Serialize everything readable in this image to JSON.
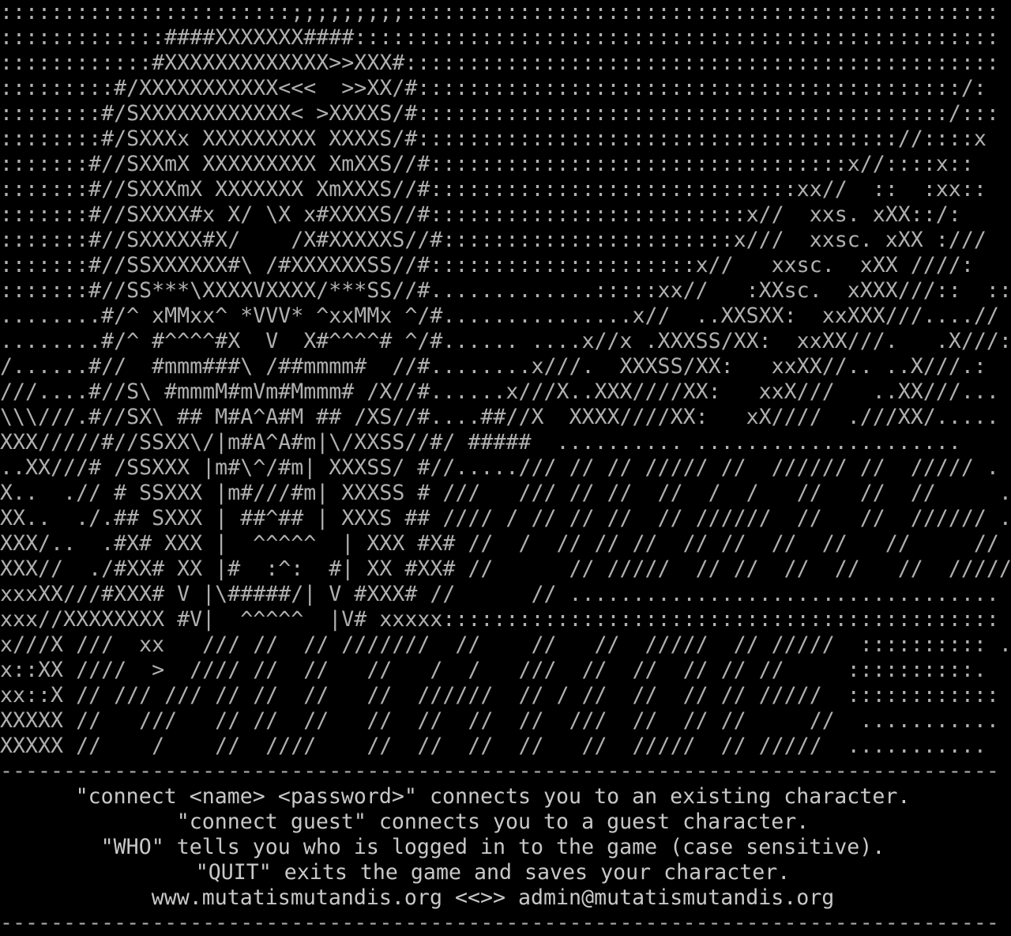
{
  "terminal": {
    "ascii_art": [
      ":::::::::::::::::::::::;;;;;;;;;:::::::::::::::::::::::::::::::::::::::::::::::",
      ":::::::::::::####XXXXXXX####:::::::::::::::::::::::::::::::::::::::::::::::::::",
      "::::::::::::#XXXXXXXXXXXXX>>XXX#:::::::::::::::::::::::::::::::::::::::::::::::",
      ":::::::::#/XXXXXXXXXXX<<<  >>XX/#:::::::::::::::::::::::::::::::::::::::::::/:",
      "::::::::#/SXXXXXXXXXXXX< >XXXXS/#::::::::::::::::::::::::::::::::::::::::::/:::",
      "::::::::#/SXXXx XXXXXXXXX XXXXS/#:::::::::::::::::::::::::::::::::::::://::::x",
      ":::::::#//SXXmX XXXXXXXXX XmXXS//#:::::::::::::::::::::::::::::::::x//::::x::",
      ":::::::#//SXXXmX XXXXXXX XmXXXS//#:::::::::::::::::::::::::::::xx//  ::  :xx::",
      ":::::::#//SXXXX#x X/ \\X x#XXXXS//#:::::::::::::::::::::::::x//  xxs. xXX::/:",
      ":::::::#//SXXXXX#X/    /X#XXXXXS//#:::::::::::::::::::::::x///  xxsc. xXX :///",
      ":::::::#//SSXXXXXX#\\ /#XXXXXXSS//#:::::::::::::::::::::x//   xxsc.  xXX ////:",
      ":::::::#//SS***\\XXXXVXXXX/***SS//#.............:::::xx//   :XXsc.  xXXX///::  ::",
      "........#/^ xMMxx^ *VVV* ^xxMMx ^/#...............x//  ..XXSXX:  xxXXX///....//",
      "........#/^ #^^^^#X  V  X#^^^^# ^/#...... ....x//x .XXXSS/XX:  xxXX///.   .X///:",
      "/......#//  #mmm###\\ /##mmmm#  //#........x///.  XXXSS/XX:   xxXX//.. ..X///.:",
      "///....#//S\\ #mmmM#mVm#Mmmm# /X//#......x///X..XXX////XX:   xxX///   ..XX///...",
      "\\\\\\///.#//SX\\ ## M#A^A#M ## /XS//#....##//X  XXXX////XX:   xX////  .///XX/.....",
      "XXX/////#//SSXX\\/|m#A^A#m|\\/XXSS//#/ #####  .......... .....................",
      "..XX///# /SSXXX |m#\\^/#m| XXXSS/ #//...../// // // ///// //  ////// //  ///// .",
      "X..  .// # SSXXX |m#///#m| XXXSS # ///   /// // //  //  /  /   //   //  //     .",
      "XX..  ./.## SXXX | ##^## | XXXS ## //// / // // //  // //////  //   //  ////// .",
      "XXX/..  .#X# XXX |  ^^^^^  | XXX #X# //  /  // // //  // //  //  //   //     // .",
      "XXX//  ./#XX# XX |#  :^:  #| XX #XX# //      // /////  // //  //  //   //  ///// .",
      "xxxXX///#XXX# V |\\#####/| V #XXX# //      // .................................. .",
      "xxx//XXXXXXXX #V|  ^^^^^  |V# xxxxx:::::::::::::::::::::::::::::::::::::::::::: .",
      "x///X ///  xx   /// //  // ///////  //    //   //  /////  // /////  :::::::::: .",
      "x::XX ////  >  //// //  //   //   /  /   ///  //  //  // // //     ::::::::::.",
      "xx::X // /// /// // //  //   //  //////  // / //  //  // // /////  ::::::::::::",
      "XXXXX //   ///   // //  //   //  //  //  //  ///  //  // //     //  ...........",
      "XXXXX //    /    //  ////    //  //  //  //   //  /////  // /////  ..........."
    ],
    "separator_top": "-------------------------------------------------------------------------------",
    "help_lines": [
      "\"connect <name> <password>\" connects you to an existing character.",
      "\"connect guest\" connects you to a guest character.",
      "\"WHO\" tells you who is logged in to the game (case sensitive).",
      "\"QUIT\" exits the game and saves your character.",
      "www.mutatismutandis.org <<>> admin@mutatismutandis.org"
    ],
    "separator_bottom": "-------------------------------------------------------------------------------"
  }
}
